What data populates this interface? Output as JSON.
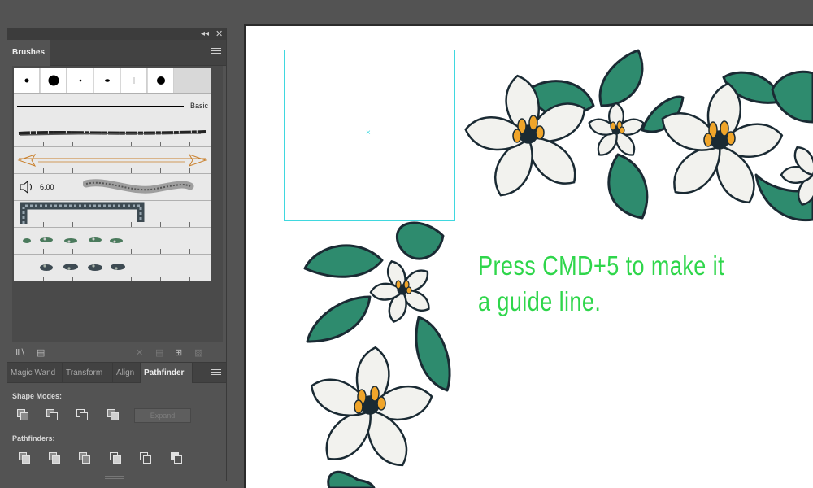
{
  "brushes_panel": {
    "tab_label": "Brushes",
    "collapse_icon": "double-chevron-left-icon",
    "close_icon": "close-icon",
    "menu_icon": "panel-menu-icon",
    "basic_label": "Basic",
    "size_value": "6.00"
  },
  "panel_footer_icons": [
    "brush-libraries-icon",
    "library-panel-icon",
    "remove-stroke-icon",
    "brush-options-icon",
    "new-brush-icon",
    "delete-brush-icon"
  ],
  "bottom_tabs": [
    {
      "label": "Magic Wand"
    },
    {
      "label": "Transform"
    },
    {
      "label": "Align"
    },
    {
      "label": "Pathfinder"
    }
  ],
  "pathfinder": {
    "shape_modes_label": "Shape Modes:",
    "expand_label": "Expand",
    "pathfinders_label": "Pathfinders:"
  },
  "canvas": {
    "instruction_line1": "Press CMD+5 to make it",
    "instruction_line2": "a guide line.",
    "guide_marker": "×"
  },
  "colors": {
    "instruction": "#2fd64b",
    "guide": "#3fd8df",
    "leaf": "#2e8b6e",
    "petal": "#f2f2ee",
    "stamen": "#f0a52a"
  }
}
